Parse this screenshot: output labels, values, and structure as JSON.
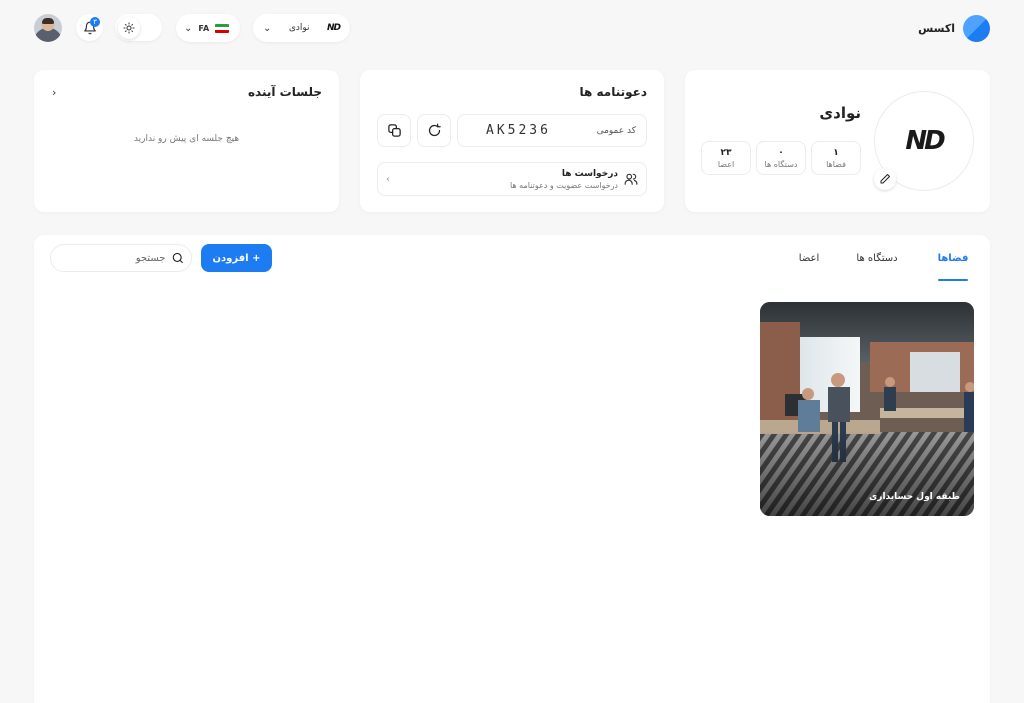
{
  "header": {
    "brand_name": "اکسس",
    "org_switch_name": "نوادی",
    "org_mini_logo": "ND",
    "language_code": "FA",
    "notification_count": "۳",
    "icons": {
      "brand": "brand-logo",
      "chevron": "chevron-down-icon",
      "theme": "sun-icon",
      "notification": "bell-icon",
      "avatar": "user-avatar"
    }
  },
  "org_card": {
    "logo_text": "ND",
    "title": "نوادی",
    "stats": {
      "spaces": {
        "value": "۱",
        "label": "فضاها"
      },
      "devices": {
        "value": "۰",
        "label": "دستگاه ها"
      },
      "members": {
        "value": "۲۳",
        "label": "اعضا"
      }
    }
  },
  "invite_card": {
    "title": "دعوتنامه ها",
    "code_label": "کد عمومی",
    "code_value": "AK5236",
    "requests_title": "درخواست ها",
    "requests_subtitle": "درخواست عضویت و دعوتنامه ها"
  },
  "sessions_card": {
    "title": "جلسات آینده",
    "empty_message": "هیچ جلسه ای پیش رو ندارید"
  },
  "main": {
    "tabs": [
      {
        "label": "فضاها",
        "active": true
      },
      {
        "label": "دستگاه ها",
        "active": false
      },
      {
        "label": "اعضا",
        "active": false
      }
    ],
    "add_button_label": "افزودن +",
    "search_placeholder": "جستجو",
    "spaces": [
      {
        "label": "طبقه اول حسابداری"
      }
    ]
  },
  "colors": {
    "accent": "#1d7cf2",
    "background": "#f7f7f8",
    "card": "#ffffff",
    "border": "#ececec"
  }
}
